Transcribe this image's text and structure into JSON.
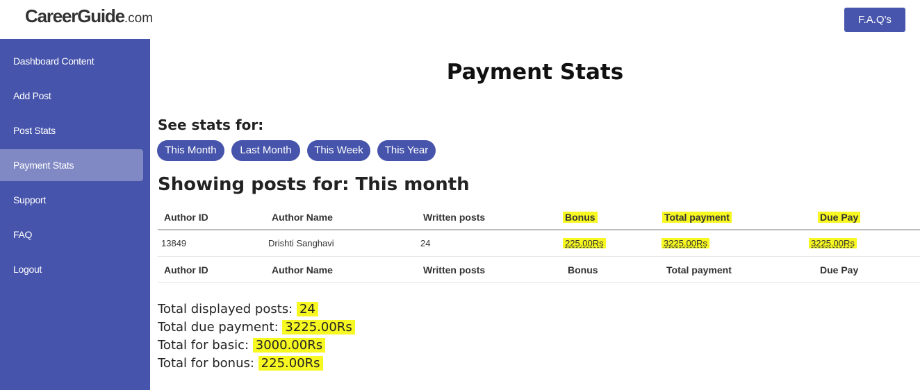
{
  "header": {
    "logo_brand": "CareerGuide",
    "logo_tld": ".com",
    "faq_button": "F.A.Q's"
  },
  "sidebar": {
    "items": [
      {
        "label": "Dashboard Content"
      },
      {
        "label": "Add Post"
      },
      {
        "label": "Post Stats"
      },
      {
        "label": "Payment Stats",
        "active": true
      },
      {
        "label": "Support"
      },
      {
        "label": "FAQ"
      },
      {
        "label": "Logout"
      }
    ]
  },
  "main": {
    "title": "Payment Stats",
    "see_stats_label": "See stats for:",
    "filters": [
      "This Month",
      "Last Month",
      "This Week",
      "This Year"
    ],
    "showing_label": "Showing posts for: This month"
  },
  "table": {
    "columns": [
      "Author ID",
      "Author Name",
      "Written posts",
      "Bonus",
      "Total payment",
      "Due Pay"
    ],
    "rows": [
      [
        "13849",
        "Drishti Sanghavi",
        "24",
        "225.00Rs",
        "3225.00Rs",
        "3225.00Rs"
      ]
    ]
  },
  "totals": {
    "posts_label": "Total displayed posts:",
    "posts_value": "24",
    "due_label": "Total due payment:",
    "due_value": "3225.00Rs",
    "basic_label": "Total for basic:",
    "basic_value": "3000.00Rs",
    "bonus_label": "Total for bonus:",
    "bonus_value": "225.00Rs"
  },
  "colors": {
    "accent": "#4654ab",
    "active_item": "#8089c4",
    "highlight": "#f7f722"
  }
}
